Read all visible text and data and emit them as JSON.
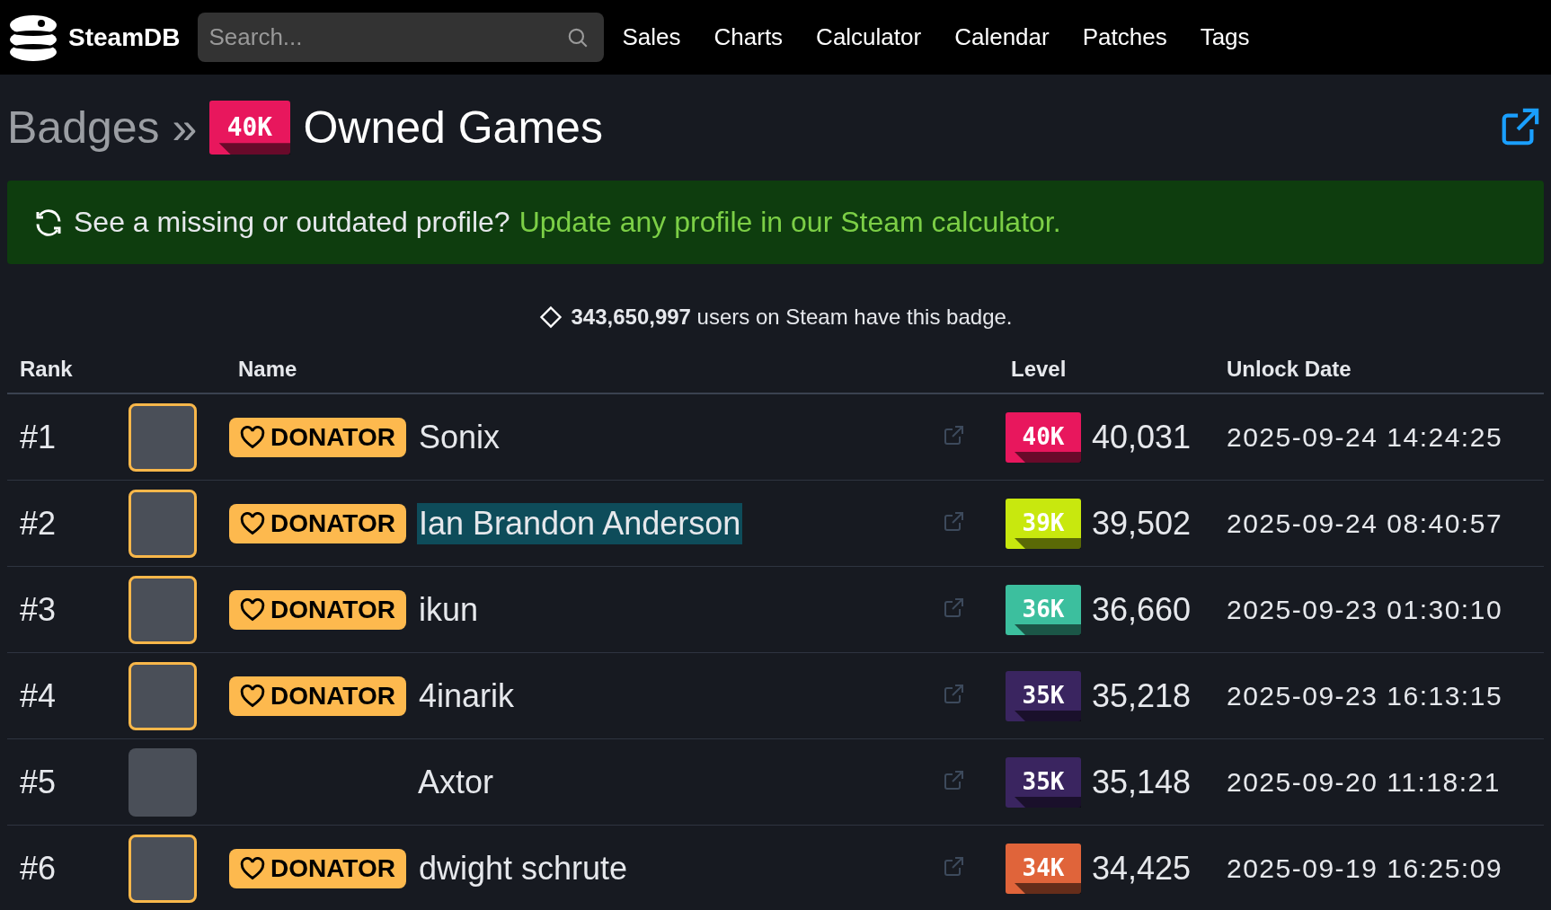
{
  "nav": {
    "logo": "SteamDB",
    "search": {
      "placeholder": "Search..."
    },
    "links": [
      "Sales",
      "Charts",
      "Calculator",
      "Calendar",
      "Patches",
      "Tags"
    ]
  },
  "title": {
    "breadcrumb": "Badges",
    "separator": "»",
    "badge": {
      "label": "40K",
      "color": "#e8175d"
    },
    "text": "Owned Games"
  },
  "banner": {
    "text": "See a missing or outdated profile?",
    "link": "Update any profile in our Steam calculator."
  },
  "summary": "**343,650,997** users on Steam have this badge.",
  "table": {
    "columns": [
      "Rank",
      "Name",
      "Level",
      "Unlock Date"
    ],
    "rows": [
      {
        "rank": "#1",
        "donator": true,
        "donator_label": "DONATOR",
        "name": "Sonix",
        "highlighted": false,
        "badge": {
          "label": "40K",
          "color": "#e8175d"
        },
        "level": "40,031",
        "date": "2025-09-24 14:24:25"
      },
      {
        "rank": "#2",
        "donator": true,
        "donator_label": "DONATOR",
        "name": "Ian Brandon Anderson",
        "highlighted": true,
        "badge": {
          "label": "39K",
          "color": "#c8e80e"
        },
        "level": "39,502",
        "date": "2025-09-24 08:40:57"
      },
      {
        "rank": "#3",
        "donator": true,
        "donator_label": "DONATOR",
        "name": "ikun",
        "highlighted": false,
        "badge": {
          "label": "36K",
          "color": "#3cbf9e"
        },
        "level": "36,660",
        "date": "2025-09-23 01:30:10"
      },
      {
        "rank": "#4",
        "donator": true,
        "donator_label": "DONATOR",
        "name": "4inarik",
        "highlighted": false,
        "badge": {
          "label": "35K",
          "color": "#3a2560"
        },
        "level": "35,218",
        "date": "2025-09-23 16:13:15"
      },
      {
        "rank": "#5",
        "donator": false,
        "name": "Axtor",
        "highlighted": false,
        "badge": {
          "label": "35K",
          "color": "#3a2560"
        },
        "level": "35,148",
        "date": "2025-09-20 11:18:21"
      },
      {
        "rank": "#6",
        "donator": true,
        "donator_label": "DONATOR",
        "name": "dwight schrute",
        "highlighted": false,
        "badge": {
          "label": "34K",
          "color": "#e0643a"
        },
        "level": "34,425",
        "date": "2025-09-19 16:25:09"
      }
    ]
  }
}
